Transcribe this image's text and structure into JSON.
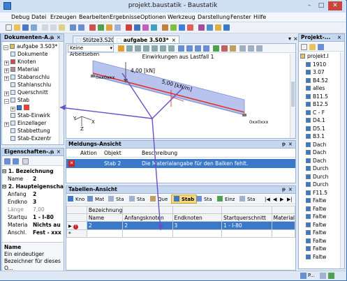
{
  "window": {
    "title": "projekt.baustatik - Baustatik"
  },
  "menu": [
    "Debug",
    "Datei",
    "Erzeugen",
    "Bearbeiten",
    "Ergebnisse",
    "Optionen",
    "Werkzeug",
    "Darstellung",
    "Fenster",
    "Hilfe"
  ],
  "doc_panel": {
    "title": "Dokumenten-A...",
    "root": "aufgabe 3.S03*",
    "items": [
      "Dokumente",
      "Knoten",
      "Material",
      "Stabanschlu",
      "Stahlanschlu",
      "Querschnitt",
      "Stab",
      "Stab-Einwirk",
      "Einzellager",
      "Stabbettung",
      "Stab-Exzentr"
    ]
  },
  "props_panel": {
    "title": "Eigenschaften-...",
    "rows": [
      {
        "label": "1. Bezeichnung",
        "value": ""
      },
      {
        "label": "Name",
        "value": "2"
      },
      {
        "label": "2. Haupteigenscha",
        "value": ""
      },
      {
        "label": "Anfang",
        "value": "2"
      },
      {
        "label": "Endkno",
        "value": "3"
      },
      {
        "label": "Länge",
        "value": "7,00"
      },
      {
        "label": "Startqu",
        "value": "1 - I-80"
      },
      {
        "label": "Materia",
        "value": "Nichts au"
      },
      {
        "label": "Anschl.",
        "value": "Fest - xxx"
      }
    ],
    "desc_title": "Name",
    "desc_text": "Ein eindeutiger Bezeichner für dieses O..."
  },
  "tabs": [
    "Stütze3.S20",
    "aufgabe 3.S03*"
  ],
  "view": {
    "dropdown": "Keine Arbeitseben",
    "caption": "Einwirkungen aus Lastfall 1",
    "load_point": "4,00 [kN]",
    "load_line": "5,00 [kN/m]",
    "support_left": "0xx0xxx",
    "support_right": "0xx0xxx",
    "axis_y": "Y",
    "axis_z": "Z",
    "axis_x": "X"
  },
  "messages": {
    "title": "Meldungs-Ansicht",
    "headers": [
      "Aktion",
      "Objekt",
      "Beschreibung"
    ],
    "row": {
      "object": "Stab 2",
      "description": "Die Materialangabe für den Balken fehlt."
    }
  },
  "tables": {
    "title": "Tabellen-Ansicht",
    "tabs": [
      "Kno",
      "Mat",
      "Sta",
      "Sta",
      "Que",
      "Stab",
      "Sta",
      "Einz",
      "Sta"
    ],
    "headers": [
      "Bezeichnung",
      "Anfangsknoten",
      "Endknoten",
      "Startquerschnitt",
      "Material"
    ],
    "subheader": "Name",
    "rows": [
      [
        "2",
        "2",
        "3",
        "1 - I-80",
        ""
      ]
    ],
    "new_row": "*"
  },
  "project_panel": {
    "title": "Projekt-...",
    "items": [
      "projekt.l",
      "1910",
      "3.07",
      "B4.52",
      "alles",
      "B11.5",
      "B12.5",
      "C - F",
      "D4.1",
      "D5.1",
      "B3.1",
      "Dach",
      "Dach",
      "Dach",
      "Durch",
      "Durch",
      "Durch",
      "F11.5",
      "Faltw",
      "Faltw",
      "Faltw",
      "Faltw",
      "Faltw",
      "Faltw",
      "Faltw",
      "Faltw"
    ]
  },
  "status": {
    "p_label": "P..."
  },
  "colors": {
    "accent": "#3a78c9",
    "error": "#cc2222",
    "beam": "#e03030",
    "load": "#b9c4ee"
  }
}
